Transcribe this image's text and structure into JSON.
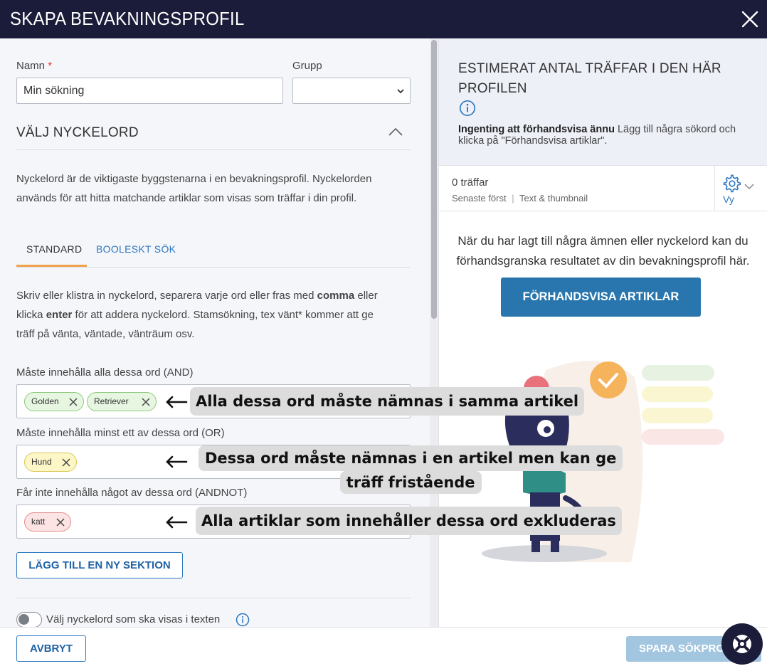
{
  "header": {
    "title": "SKAPA BEVAKNINGSPROFIL"
  },
  "form": {
    "name_label": "Namn",
    "name_required_mark": "*",
    "name_value": "Min sökning",
    "group_label": "Grupp",
    "group_value": ""
  },
  "keywords": {
    "section_title": "VÄLJ NYCKELORD",
    "intro_line1": "Nyckelord är de viktigaste byggstenarna i en bevakningsprofil. Nyckelorden",
    "intro_line2": "används för att hitta matchande artiklar som visas som träffar i din profil.",
    "tabs": [
      {
        "label": "STANDARD"
      },
      {
        "label": "BOOLESKT SÖK"
      }
    ],
    "instr_line1_a": "Skriv eller klistra in nyckelord, separera varje ord eller fras med ",
    "instr_line1_b": "comma",
    "instr_line1_c": " eller",
    "instr_line2_a": "klicka ",
    "instr_line2_b": "enter",
    "instr_line2_c": " för att addera nyckelord. Stamsökning, tex vänt* kommer att ge",
    "instr_line3": "träff på vänta, väntade, vänträum osv.",
    "and_label": "Måste innehålla alla dessa ord (AND)",
    "and_tags": [
      "Golden",
      "Retriever"
    ],
    "or_label": "Måste innehålla minst ett av dessa ord (OR)",
    "or_tags": [
      "Hund"
    ],
    "not_label": "Får inte innehålla något av dessa ord (ANDNOT)",
    "not_tags": [
      "katt"
    ],
    "add_section_button": "LÄGG TILL EN NY SEKTION",
    "toggle_label": "Välj nyckelord som ska visas i texten"
  },
  "annotations": {
    "and": "Alla dessa ord måste nämnas i samma artikel",
    "or_line1": "Dessa ord måste nämnas i en artikel men kan ge",
    "or_line2": "träff fristående",
    "not": "Alla artiklar som innehåller dessa ord exkluderas"
  },
  "estimate": {
    "title": "ESTIMERAT ANTAL TRÄFFAR I DEN HÄR PROFILEN",
    "empty_bold": "Ingenting att förhandsvisa ännu",
    "empty_text": " Lägg till några sökord och klicka på \"Förhandsvisa artiklar\"."
  },
  "hits": {
    "count": "0 träffar",
    "sort": "Senaste först",
    "separator": "|",
    "view_mode": "Text & thumbnail",
    "view_label": "Vy"
  },
  "preview": {
    "line1": "När du har lagt till några ämnen eller nyckelord kan du",
    "line2": "förhandsgranska resultatet av din bevakningsprofil här.",
    "button": "FÖRHANDSVISA ARTIKLAR"
  },
  "footer": {
    "cancel": "AVBRYT",
    "save": "SPARA SÖKPROFIL"
  },
  "colors": {
    "header_bg": "#1b1b3a",
    "accent_blue": "#2876ad",
    "tab_underline": "#f0a24b",
    "tag_green": "#e7f6e1",
    "tag_yellow": "#fdf6c7",
    "tag_red": "#fde4e4",
    "save_disabled": "#a3c6e0"
  }
}
